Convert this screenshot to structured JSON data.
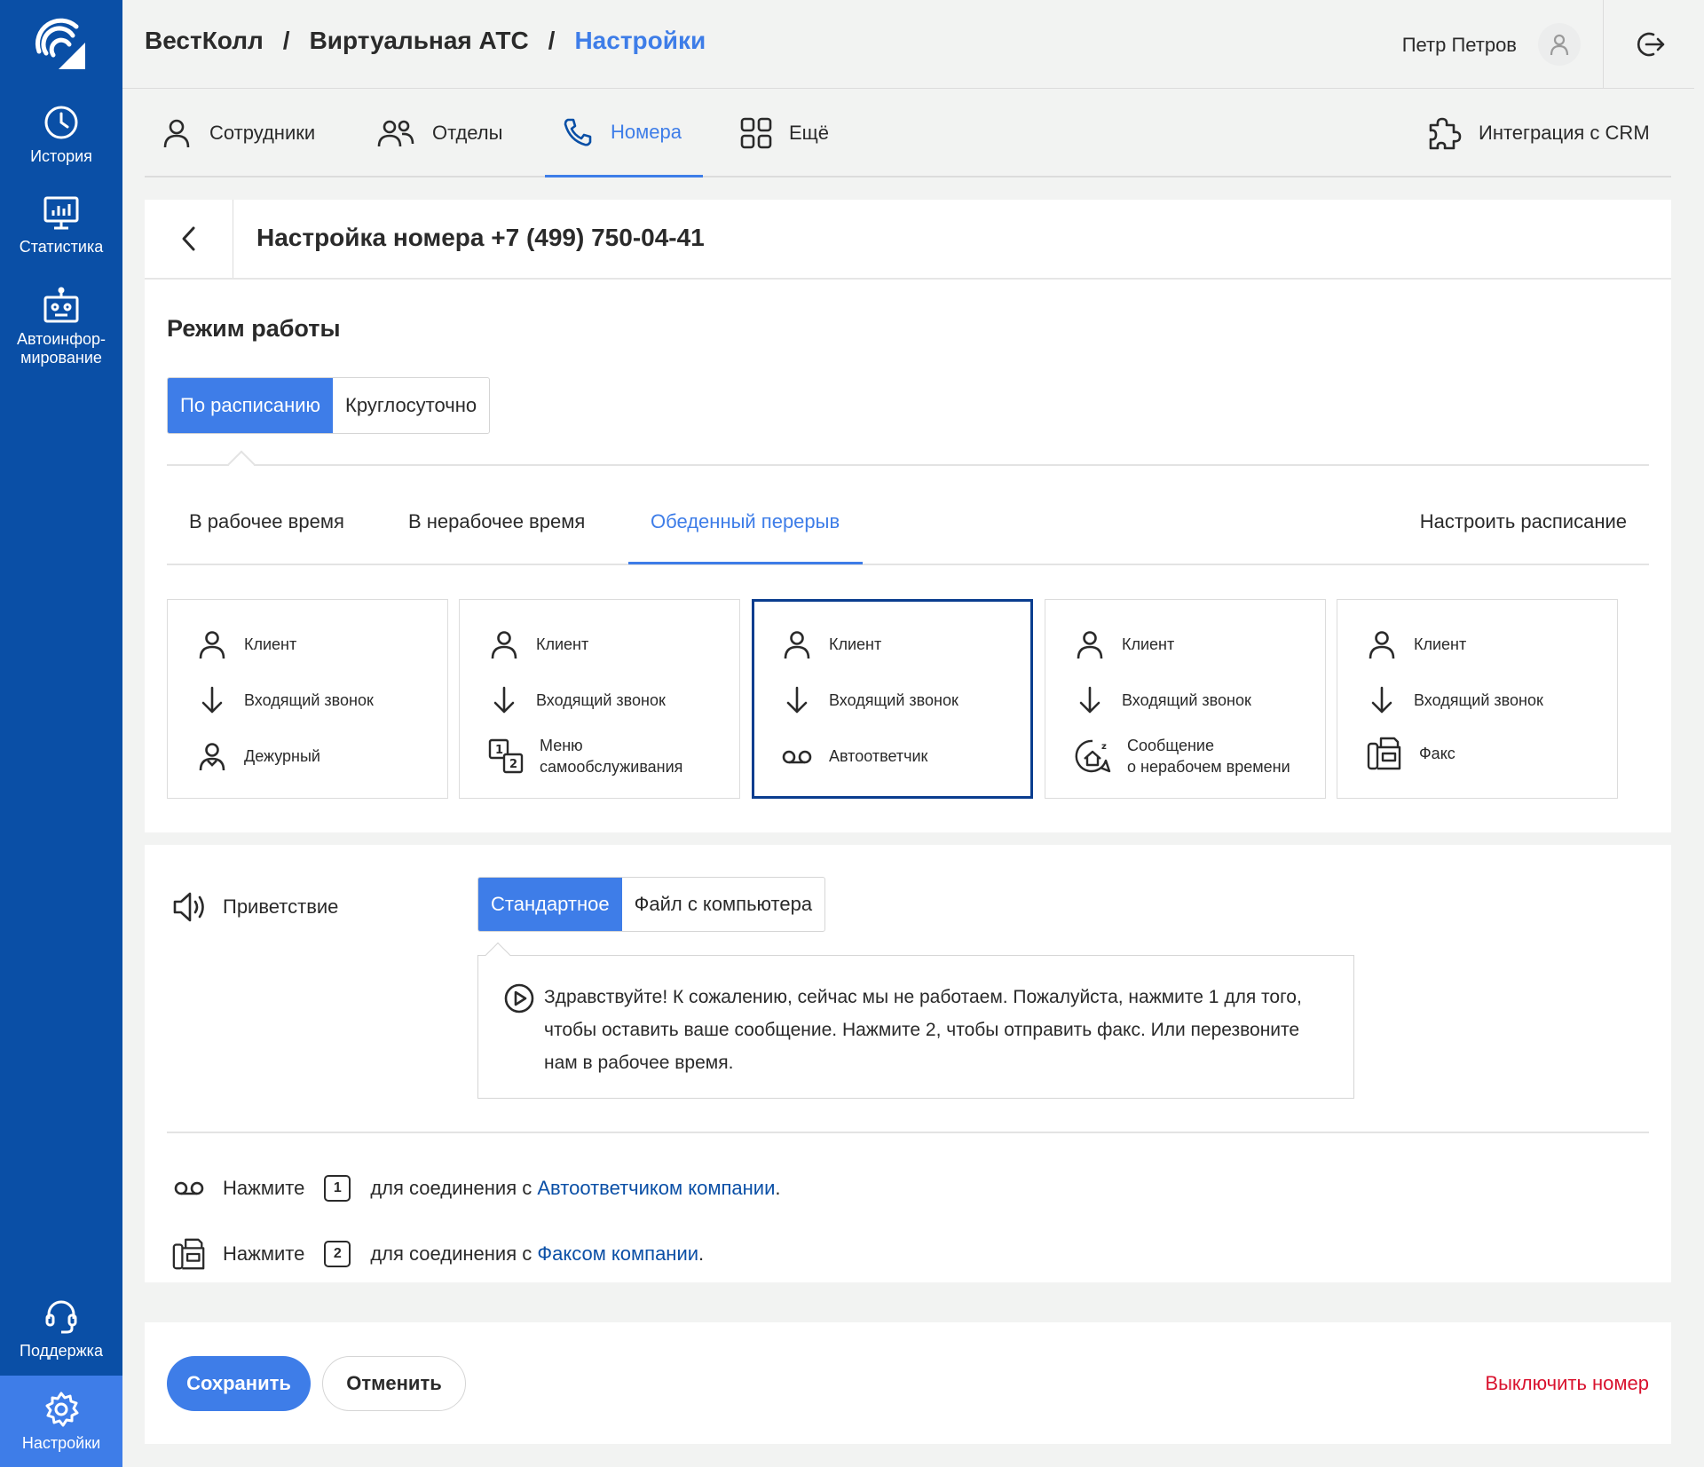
{
  "sidebar": {
    "items": [
      {
        "label": "История",
        "icon": "clock-icon"
      },
      {
        "label": "Статистика",
        "icon": "stats-monitor-icon"
      },
      {
        "label": "Автоинфор-",
        "label2": "мирование",
        "icon": "robot-icon"
      },
      {
        "label": "Поддержка",
        "icon": "headset-icon"
      },
      {
        "label": "Настройки",
        "icon": "gear-icon"
      }
    ]
  },
  "header": {
    "crumbs": [
      "ВестКолл",
      "Виртуальная АТС",
      "Настройки"
    ],
    "separator": "/",
    "user_name": "Петр Петров"
  },
  "tabs": [
    {
      "label": "Сотрудники",
      "icon": "person-icon"
    },
    {
      "label": "Отделы",
      "icon": "people-icon"
    },
    {
      "label": "Номера",
      "icon": "phone-icon"
    },
    {
      "label": "Ещё",
      "icon": "grid-icon"
    },
    {
      "label": "Интеграция с CRM",
      "icon": "puzzle-icon"
    }
  ],
  "panel": {
    "title": "Настройка номера +7 (499) 750-04-41",
    "section_title": "Режим работы",
    "mode_options": [
      "По расписанию",
      "Круглосуточно"
    ],
    "subtabs": [
      "В рабочее время",
      "В нерабочее время",
      "Обеденный перерыв"
    ],
    "schedule_link": "Настроить расписание",
    "cards": [
      {
        "client": "Клиент",
        "call": "Входящий звонок",
        "target": "Дежурный",
        "target2": ""
      },
      {
        "client": "Клиент",
        "call": "Входящий звонок",
        "target": "Меню",
        "target2": "самообслуживания"
      },
      {
        "client": "Клиент",
        "call": "Входящий звонок",
        "target": "Автоответчик",
        "target2": ""
      },
      {
        "client": "Клиент",
        "call": "Входящий звонок",
        "target": "Сообщение",
        "target2": "о нерабочем времени"
      },
      {
        "client": "Клиент",
        "call": "Входящий звонок",
        "target": "Факс",
        "target2": ""
      }
    ]
  },
  "greeting": {
    "label": "Приветствие",
    "options": [
      "Стандартное",
      "Файл с компьютера"
    ],
    "message": "Здравствуйте! К сожалению, сейчас мы не работаем. Пожалуйста, нажмите 1 для того, чтобы оставить ваше сообщение. Нажмите 2, чтобы отправить факс. Или перезвоните нам в рабочее время."
  },
  "press": [
    {
      "prefix": "Нажмите",
      "key": "1",
      "text": "для соединения с",
      "link": "Автоответчиком компании",
      "suffix": "."
    },
    {
      "prefix": "Нажмите",
      "key": "2",
      "text": "для соединения с",
      "link": "Факсом компании",
      "suffix": "."
    }
  ],
  "footer": {
    "save": "Сохранить",
    "cancel": "Отменить",
    "disable": "Выключить номер"
  },
  "colors": {
    "sidebar": "#0a4fa6",
    "accent": "#3e7de8",
    "selected_border": "#0a3d8f",
    "danger": "#d9122e"
  }
}
